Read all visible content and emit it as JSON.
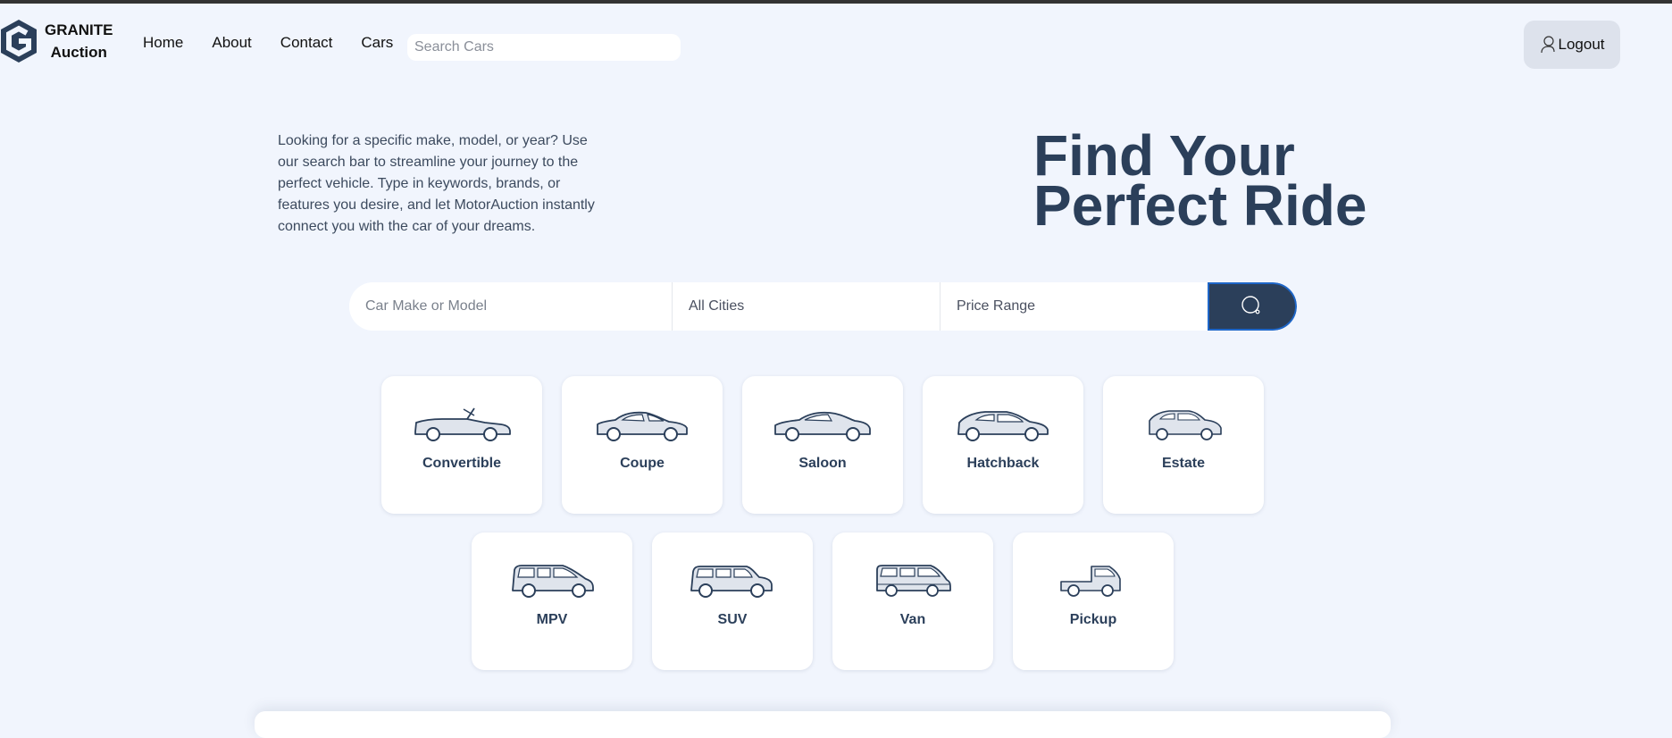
{
  "header": {
    "logo_line1": "GRANITE",
    "logo_line2": "Auction",
    "nav": [
      "Home",
      "About",
      "Contact",
      "Cars"
    ],
    "search_placeholder": "Search Cars",
    "logout_label": "Logout"
  },
  "hero": {
    "description": "Looking for a specific make, model, or year? Use our search bar to streamline your journey to the perfect vehicle. Type in keywords, brands, or features you desire, and let MotorAuction instantly connect you with the car of your dreams.",
    "title_line1": "Find Your",
    "title_line2": "Perfect Ride"
  },
  "search": {
    "make_placeholder": "Car Make or Model",
    "city_value": "All Cities",
    "price_value": "Price Range"
  },
  "car_types": {
    "row1": [
      {
        "label": "Convertible",
        "icon": "convertible-icon"
      },
      {
        "label": "Coupe",
        "icon": "coupe-icon"
      },
      {
        "label": "Saloon",
        "icon": "saloon-icon"
      },
      {
        "label": "Hatchback",
        "icon": "hatchback-icon"
      },
      {
        "label": "Estate",
        "icon": "estate-icon"
      }
    ],
    "row2": [
      {
        "label": "MPV",
        "icon": "mpv-icon"
      },
      {
        "label": "SUV",
        "icon": "suv-icon"
      },
      {
        "label": "Van",
        "icon": "van-icon"
      },
      {
        "label": "Pickup",
        "icon": "pickup-icon"
      }
    ]
  },
  "colors": {
    "background": "#f1f5fd",
    "primary": "#2b3f5a",
    "button_border": "#1e66c8"
  }
}
